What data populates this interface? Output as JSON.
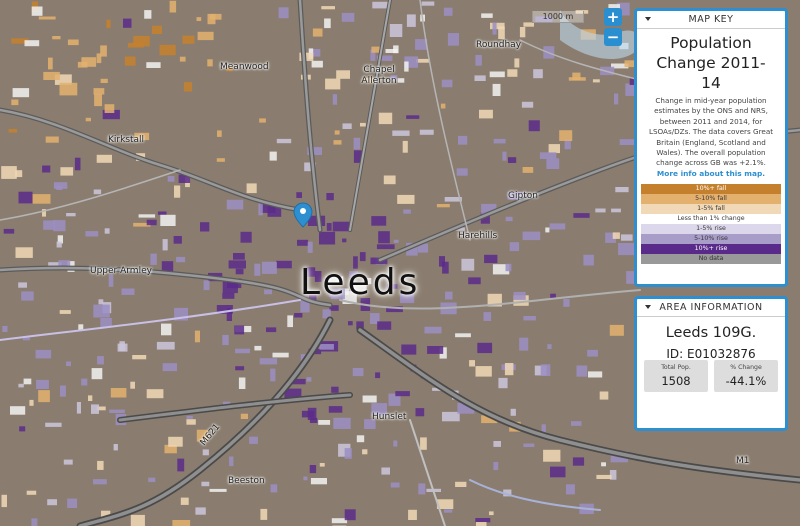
{
  "map": {
    "city_label": "Leeds",
    "places": [
      "Roundhay",
      "Meanwood",
      "Chapel Allerton",
      "Kirkstall",
      "Upper Armley",
      "Harehills",
      "Gipton",
      "Hunslet",
      "Beeston",
      "M1",
      "M621"
    ],
    "scale_label": "1000 m",
    "zoom_in": "+",
    "zoom_out": "−",
    "colors": {
      "base": "#8a7d6f",
      "rise_10": "#5a2a8a",
      "rise_5_10": "#9b8ec4",
      "rise_1_5": "#cbc6dc",
      "no_change": "#f2f2f2",
      "fall_1_5": "#f1d8b6",
      "fall_5_10": "#e3b06e",
      "fall_10": "#c5802e",
      "no_data": "#8a8a8a",
      "accent": "#2d8fcf"
    }
  },
  "map_key": {
    "header": "MAP KEY",
    "title": "Population Change 2011-14",
    "description": "Change in mid-year population estimates by the ONS and NRS, between 2011 and 2014, for LSOAs/DZs. The data covers Great Britain (England, Scotland and Wales). The overall population change across GB was +2.1%.",
    "link": "More info about this map.",
    "legend": [
      {
        "label": "10%+ fall",
        "color": "#c5802e",
        "text": "#ffffff"
      },
      {
        "label": "5-10% fall",
        "color": "#e3b06e",
        "text": "#3a3a3a"
      },
      {
        "label": "1-5% fall",
        "color": "#f1d8b6",
        "text": "#3a3a3a"
      },
      {
        "label": "Less than 1% change",
        "color": "#ffffff",
        "text": "#3a3a3a"
      },
      {
        "label": "1-5% rise",
        "color": "#dcd7ea",
        "text": "#3a3a3a"
      },
      {
        "label": "5-10% rise",
        "color": "#a89cc9",
        "text": "#3a3a3a"
      },
      {
        "label": "10%+ rise",
        "color": "#5a2a8a",
        "text": "#ffffff"
      },
      {
        "label": "No data",
        "color": "#999999",
        "text": "#333333"
      }
    ]
  },
  "area_info": {
    "header": "AREA INFORMATION",
    "name": "Leeds 109G.",
    "id": "ID: E01032876",
    "total_pop_label": "Total Pop.",
    "total_pop": "1508",
    "change_label": "% Change",
    "change": "-44.1%"
  }
}
